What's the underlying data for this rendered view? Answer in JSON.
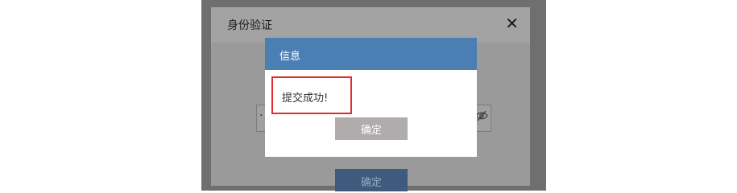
{
  "base_dialog": {
    "title": "身份验证",
    "close_glyph": "✕",
    "password_dots": "···",
    "submit_label": "确定"
  },
  "message_dialog": {
    "title": "信息",
    "text": "提交成功!",
    "ok_label": "确定"
  },
  "icons": {
    "close": "close-icon",
    "eye": "eye-icon"
  },
  "colors": {
    "overlay": "#6f6f6f",
    "header_blue": "#4a7fb3",
    "highlight_red": "#e12c2c",
    "ok_button_gray": "#b0acac",
    "base_button_blue": "#3e5b7e"
  }
}
